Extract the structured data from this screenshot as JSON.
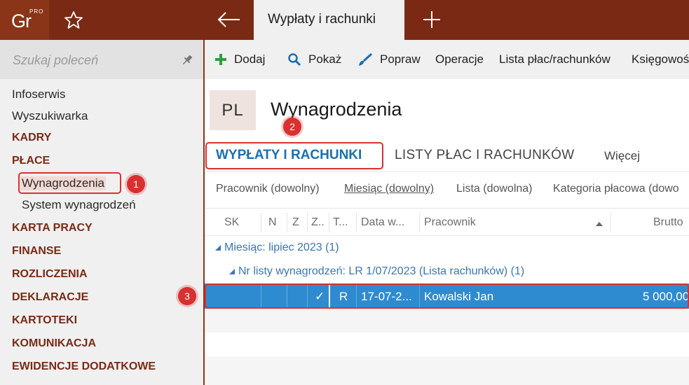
{
  "app": {
    "logo_text": "Gr",
    "logo_badge": "PRO",
    "active_tab": "Wypłaty i rachunki"
  },
  "sidebar": {
    "search_placeholder": "Szukaj poleceń",
    "items": [
      {
        "label": "Infoserwis",
        "kind": "link"
      },
      {
        "label": "Wyszukiwarka",
        "kind": "link"
      },
      {
        "label": "KADRY",
        "kind": "category"
      },
      {
        "label": "PŁACE",
        "kind": "category"
      },
      {
        "label": "Wynagrodzenia",
        "kind": "sub",
        "selected": true
      },
      {
        "label": "System wynagrodzeń",
        "kind": "sub"
      },
      {
        "label": "KARTA PRACY",
        "kind": "category"
      },
      {
        "label": "FINANSE",
        "kind": "category"
      },
      {
        "label": "ROZLICZENIA",
        "kind": "category"
      },
      {
        "label": "DEKLARACJE",
        "kind": "category"
      },
      {
        "label": "KARTOTEKI",
        "kind": "category"
      },
      {
        "label": "KOMUNIKACJA",
        "kind": "category"
      },
      {
        "label": "EWIDENCJE DODATKOWE",
        "kind": "category"
      }
    ]
  },
  "toolbar": {
    "add": "Dodaj",
    "show": "Pokaż",
    "edit": "Popraw",
    "operations": "Operacje",
    "payroll_list": "Lista płac/rachunków",
    "accounting": "Księgowoś"
  },
  "page": {
    "badge": "PL",
    "title": "Wynagrodzenia",
    "tabs": [
      "WYPŁATY I RACHUNKI",
      "LISTY PŁAC I RACHUNKÓW",
      "Więcej"
    ]
  },
  "filters": [
    "Pracownik (dowolny)",
    "Miesiąc (dowolny)",
    "Lista (dowolna)",
    "Kategoria płacowa (dowo"
  ],
  "grid": {
    "columns": [
      "SK",
      "N",
      "Z",
      "Z..",
      "T...",
      "Data w...",
      "Pracownik",
      "Brutto"
    ],
    "group_month": "Miesiąc: lipiec 2023 (1)",
    "group_list_label": "Nr listy wynagrodzeń:",
    "group_list_value": "LR 1/07/2023 (Lista rachunków) (1)",
    "rows": [
      {
        "check": "✓",
        "type": "R",
        "date": "17-07-2...",
        "employee": "Kowalski Jan",
        "gross": "5 000,00"
      }
    ]
  },
  "callouts": [
    "1",
    "2",
    "3"
  ],
  "colors": {
    "titlebar": "#7a2a14",
    "category": "#7a2a14",
    "selected_row": "#2f8bd0",
    "accent_blue": "#1a6fb0",
    "callout": "#d93030"
  }
}
